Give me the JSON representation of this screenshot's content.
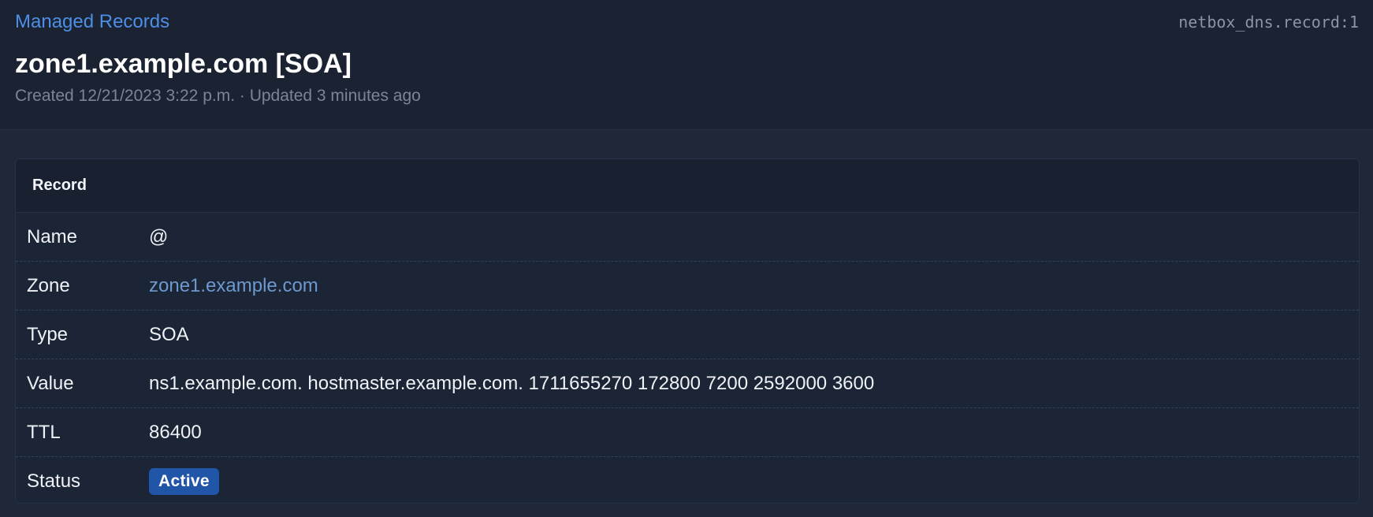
{
  "header": {
    "breadcrumb": "Managed Records",
    "object_id": "netbox_dns.record:1",
    "title": "zone1.example.com [SOA]",
    "meta": "Created 12/21/2023 3:22 p.m. · Updated 3 minutes ago"
  },
  "card": {
    "title": "Record",
    "rows": [
      {
        "label": "Name",
        "value": "@"
      },
      {
        "label": "Zone",
        "value": "zone1.example.com"
      },
      {
        "label": "Type",
        "value": "SOA"
      },
      {
        "label": "Value",
        "value": "ns1.example.com. hostmaster.example.com. 1711655270 172800 7200 2592000 3600"
      },
      {
        "label": "TTL",
        "value": "86400"
      },
      {
        "label": "Status",
        "value": "Active"
      }
    ]
  },
  "colors": {
    "link": "#4d8ee6",
    "zone_link": "#6d99cf",
    "status_active": "#2155a8"
  }
}
